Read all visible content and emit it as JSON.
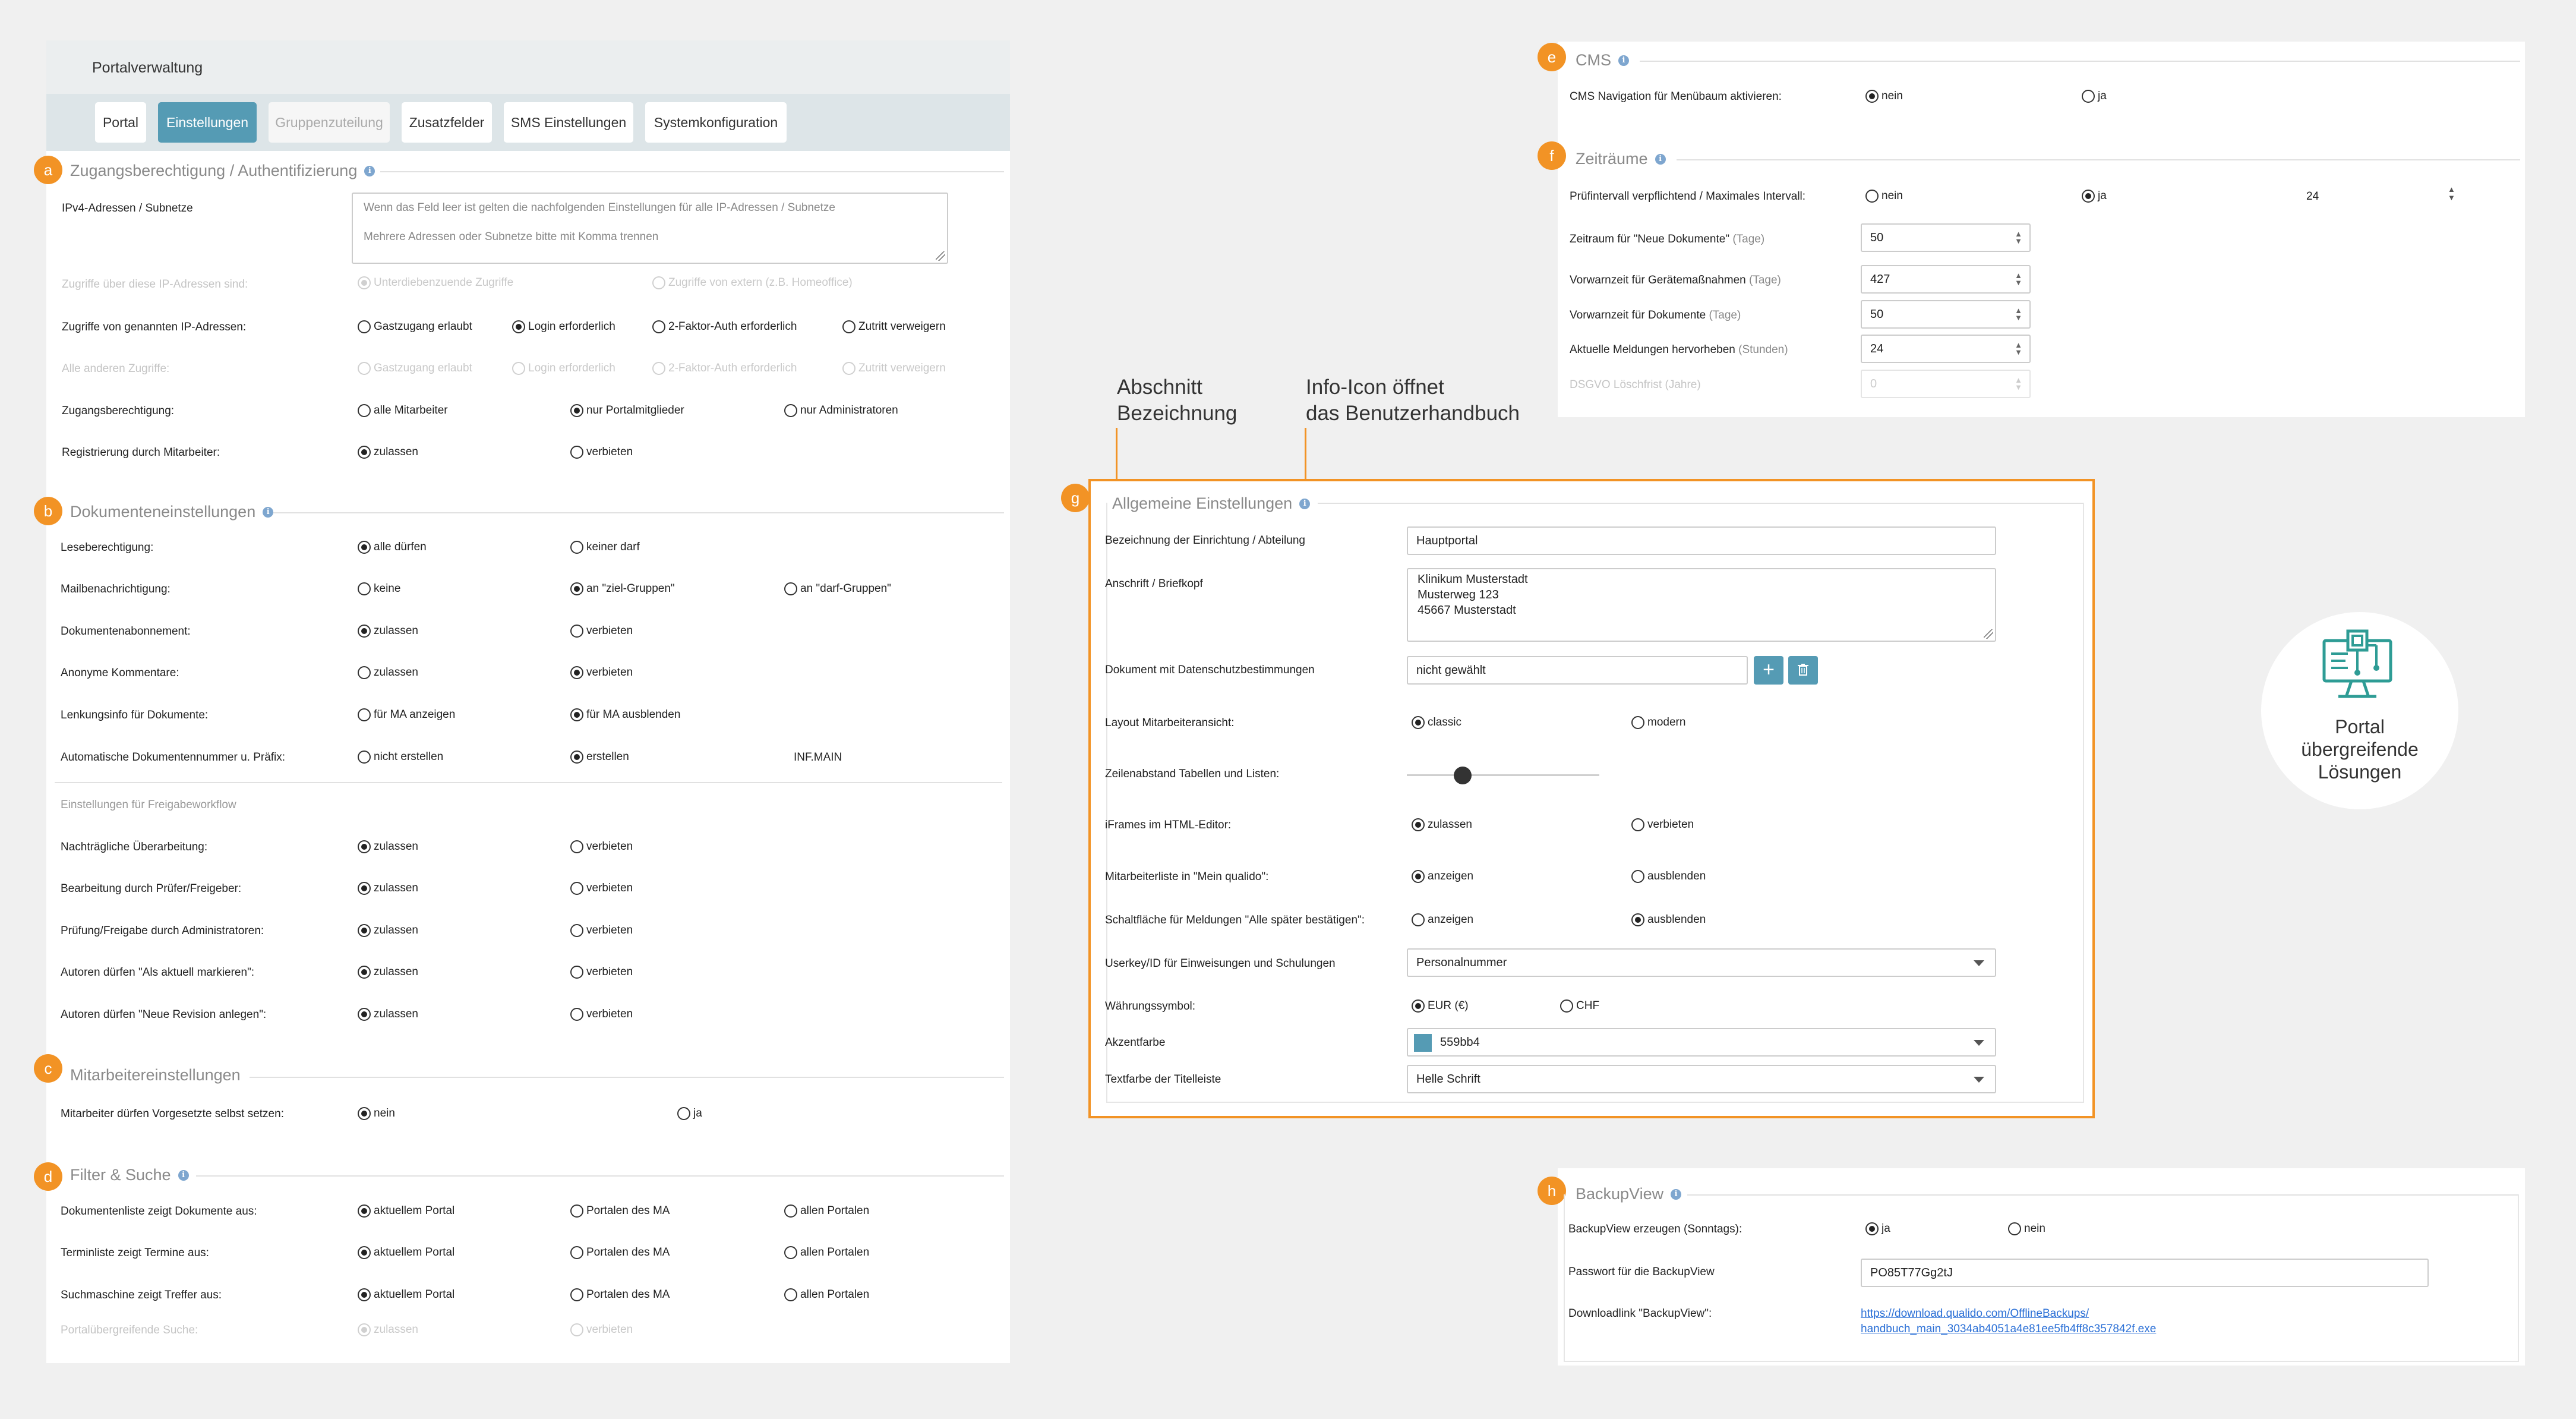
{
  "header": {
    "title": "Portalverwaltung"
  },
  "tabs": [
    {
      "label": "Portal"
    },
    {
      "label": "Einstellungen"
    },
    {
      "label": "Gruppenzuteilung"
    },
    {
      "label": "Zusatzfelder"
    },
    {
      "label": "SMS Einstellungen"
    },
    {
      "label": "Systemkonfiguration"
    }
  ],
  "badges": {
    "a": "a",
    "b": "b",
    "c": "c",
    "d": "d",
    "e": "e",
    "f": "f",
    "g": "g",
    "h": "h"
  },
  "colors": {
    "accent": "#559bb4",
    "badge": "#f29325"
  },
  "secA": {
    "title": "Zugangsberechtigung / Authentifizierung",
    "ip_label": "IPv4-Adressen / Subnetze",
    "ip_placeholder1": "Wenn das Feld leer ist gelten die nachfolgenden Einstellungen für alle IP-Adressen / Subnetze",
    "ip_placeholder2": "Mehrere Adressen oder Subnetze bitte mit Komma trennen",
    "r1": {
      "label": "Zugriffe über diese IP-Adressen sind:",
      "o1": "Unterdiebenzuende Zugriffe",
      "o2": "Zugriffe von extern (z.B. Homeoffice)"
    },
    "r2": {
      "label": "Zugriffe von genannten IP-Adressen:",
      "o1": "Gastzugang erlaubt",
      "o2": "Login erforderlich",
      "o3": "2-Faktor-Auth erforderlich",
      "o4": "Zutritt verweigern"
    },
    "r3": {
      "label": "Alle anderen Zugriffe:",
      "o1": "Gastzugang erlaubt",
      "o2": "Login erforderlich",
      "o3": "2-Faktor-Auth erforderlich",
      "o4": "Zutritt verweigern"
    },
    "r4": {
      "label": "Zugangsberechtigung:",
      "o1": "alle Mitarbeiter",
      "o2": "nur Portalmitglieder",
      "o3": "nur Administratoren"
    },
    "r5": {
      "label": "Registrierung durch Mitarbeiter:",
      "o1": "zulassen",
      "o2": "verbieten"
    }
  },
  "secB": {
    "title": "Dokumenteneinstellungen",
    "r1": {
      "label": "Leseberechtigung:",
      "o1": "alle dürfen",
      "o2": "keiner darf"
    },
    "r2": {
      "label": "Mailbenachrichtigung:",
      "o1": "keine",
      "o2": "an \"ziel-Gruppen\"",
      "o3": "an \"darf-Gruppen\""
    },
    "r3": {
      "label": "Dokumentenabonnement:",
      "o1": "zulassen",
      "o2": "verbieten"
    },
    "r4": {
      "label": "Anonyme Kommentare:",
      "o1": "zulassen",
      "o2": "verbieten"
    },
    "r5": {
      "label": "Lenkungsinfo für Dokumente:",
      "o1": "für MA anzeigen",
      "o2": "für MA ausblenden"
    },
    "r6": {
      "label": "Automatische Dokumentennummer u. Präfix:",
      "o1": "nicht erstellen",
      "o2": "erstellen",
      "prefix": "INF.MAIN"
    },
    "sub": "Einstellungen für Freigabeworkflow",
    "r7": {
      "label": "Nachträgliche Überarbeitung:",
      "o1": "zulassen",
      "o2": "verbieten"
    },
    "r8": {
      "label": "Bearbeitung durch Prüfer/Freigeber:",
      "o1": "zulassen",
      "o2": "verbieten"
    },
    "r9": {
      "label": "Prüfung/Freigabe durch Administratoren:",
      "o1": "zulassen",
      "o2": "verbieten"
    },
    "r10": {
      "label": "Autoren dürfen \"Als aktuell markieren\":",
      "o1": "zulassen",
      "o2": "verbieten"
    },
    "r11": {
      "label": "Autoren dürfen \"Neue Revision anlegen\":",
      "o1": "zulassen",
      "o2": "verbieten"
    }
  },
  "secC": {
    "title": "Mitarbeitereinstellungen",
    "r1": {
      "label": "Mitarbeiter dürfen Vorgesetzte selbst setzen:",
      "o1": "nein",
      "o2": "ja"
    }
  },
  "secD": {
    "title": "Filter & Suche",
    "r1": {
      "label": "Dokumentenliste zeigt Dokumente aus:",
      "o1": "aktuellem Portal",
      "o2": "Portalen des MA",
      "o3": "allen Portalen"
    },
    "r2": {
      "label": "Terminliste zeigt Termine aus:",
      "o1": "aktuellem Portal",
      "o2": "Portalen des MA",
      "o3": "allen Portalen"
    },
    "r3": {
      "label": "Suchmaschine zeigt Treffer aus:",
      "o1": "aktuellem Portal",
      "o2": "Portalen des MA",
      "o3": "allen Portalen"
    },
    "r4": {
      "label": "Portalübergreifende Suche:",
      "o1": "zulassen",
      "o2": "verbieten"
    }
  },
  "secE": {
    "title": "CMS",
    "r1": {
      "label": "CMS Navigation für Menübaum aktivieren:",
      "o1": "nein",
      "o2": "ja"
    }
  },
  "secF": {
    "title": "Zeiträume",
    "r1": {
      "label": "Prüfintervall verpflichtend / Maximales Intervall:",
      "o1": "nein",
      "o2": "ja",
      "value": "24"
    },
    "r2": {
      "label": "Zeitraum für \"Neue Dokumente\"",
      "unit": "(Tage)",
      "value": "50"
    },
    "r3": {
      "label": "Vorwarnzeit für Gerätemaßnahmen",
      "unit": "(Tage)",
      "value": "427"
    },
    "r4": {
      "label": "Vorwarnzeit für Dokumente",
      "unit": "(Tage)",
      "value": "50"
    },
    "r5": {
      "label": "Aktuelle Meldungen hervorheben",
      "unit": "(Stunden)",
      "value": "24"
    },
    "r6": {
      "label": "DSGVO Löschfrist",
      "unit": "(Jahre)",
      "value": "0"
    }
  },
  "secG": {
    "title": "Allgemeine Einstellungen",
    "r1": {
      "label": "Bezeichnung der Einrichtung / Abteilung",
      "value": "Hauptportal"
    },
    "r2": {
      "label": "Anschrift / Briefkopf",
      "line1": "Klinikum Musterstadt",
      "line2": "Musterweg 123",
      "line3": "45667 Musterstadt"
    },
    "r3": {
      "label": "Dokument mit Datenschutzbestimmungen",
      "value": "nicht gewählt"
    },
    "r4": {
      "label": "Layout Mitarbeiteransicht:",
      "o1": "classic",
      "o2": "modern"
    },
    "r5": {
      "label": "Zeilenabstand Tabellen und Listen:",
      "slider": 0.2
    },
    "r6": {
      "label": "iFrames im HTML-Editor:",
      "o1": "zulassen",
      "o2": "verbieten"
    },
    "r7": {
      "label": "Mitarbeiterliste in \"Mein qualido\":",
      "o1": "anzeigen",
      "o2": "ausblenden"
    },
    "r8": {
      "label": "Schaltfläche für Meldungen \"Alle später bestätigen\":",
      "o1": "anzeigen",
      "o2": "ausblenden"
    },
    "r9": {
      "label": "Userkey/ID für Einweisungen und Schulungen",
      "value": "Personalnummer"
    },
    "r10": {
      "label": "Währungssymbol:",
      "o1": "EUR (€)",
      "o2": "CHF"
    },
    "r11": {
      "label": "Akzentfarbe",
      "value": "559bb4"
    },
    "r12": {
      "label": "Textfarbe der Titelleiste",
      "value": "Helle Schrift"
    }
  },
  "secH": {
    "title": "BackupView",
    "r1": {
      "label": "BackupView erzeugen (Sonntags):",
      "o1": "ja",
      "o2": "nein"
    },
    "r2": {
      "label": "Passwort für die BackupView",
      "value": "PO85T77Gg2tJ"
    },
    "r3": {
      "label": "Downloadlink \"BackupView\":",
      "line1": "https://download.qualido.com/OfflineBackups/",
      "line2": "handbuch_main_3034ab4051a4e81ee5fb4ff8c357842f.exe"
    }
  },
  "annotations": {
    "a1_l1": "Abschnitt",
    "a1_l2": "Bezeichnung",
    "a2_l1": "Info-Icon öffnet",
    "a2_l2": "das Benutzerhandbuch"
  },
  "portal_card": {
    "l1": "Portal",
    "l2": "übergreifende",
    "l3": "Lösungen",
    "icon": "monitor-network-icon"
  }
}
